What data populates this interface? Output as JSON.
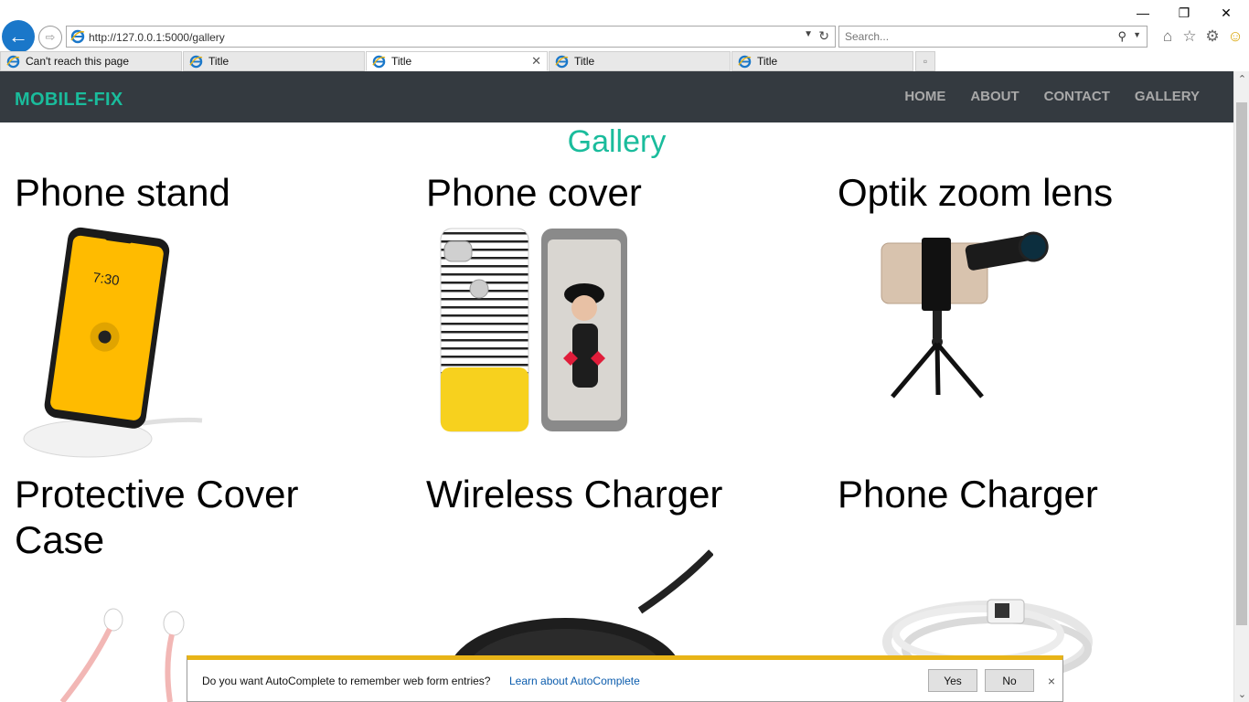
{
  "browser": {
    "url": "http://127.0.0.1:5000/gallery",
    "search_placeholder": "Search...",
    "tabs": [
      {
        "label": "Can't reach this page",
        "active": false
      },
      {
        "label": "Title",
        "active": false
      },
      {
        "label": "Title",
        "active": true
      },
      {
        "label": "Title",
        "active": false
      },
      {
        "label": "Title",
        "active": false
      }
    ],
    "window_controls": {
      "minimize": "—",
      "restore": "❐",
      "close": "✕"
    },
    "toolbar_icons": [
      "home-icon",
      "favorites-star-icon",
      "settings-gear-icon",
      "feedback-smiley-icon"
    ]
  },
  "site": {
    "brand": "MOBILE-FIX",
    "nav": [
      "HOME",
      "ABOUT",
      "CONTACT",
      "GALLERY"
    ],
    "colors": {
      "accent": "#1abc9c",
      "navbar": "#343a40",
      "navlink": "#a9a9a9"
    }
  },
  "gallery": {
    "title": "Gallery",
    "items": [
      {
        "title": "Phone stand"
      },
      {
        "title": "Phone cover"
      },
      {
        "title": "Optik zoom lens"
      },
      {
        "title": "Protective Cover Case"
      },
      {
        "title": "Wireless Charger"
      },
      {
        "title": "Phone Charger"
      }
    ]
  },
  "autocomplete_bar": {
    "message": "Do you want AutoComplete to remember web form entries?",
    "link": "Learn about AutoComplete",
    "yes": "Yes",
    "no": "No",
    "close": "×"
  }
}
